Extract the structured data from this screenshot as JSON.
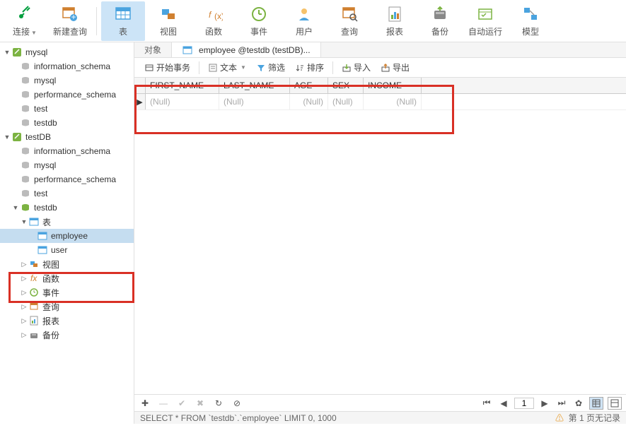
{
  "toolbar": [
    {
      "id": "connect",
      "label": "连接"
    },
    {
      "id": "newquery",
      "label": "新建查询"
    },
    {
      "id": "table",
      "label": "表",
      "active": true
    },
    {
      "id": "view",
      "label": "视图"
    },
    {
      "id": "function",
      "label": "函数"
    },
    {
      "id": "event",
      "label": "事件"
    },
    {
      "id": "user",
      "label": "用户"
    },
    {
      "id": "query",
      "label": "查询"
    },
    {
      "id": "report",
      "label": "报表"
    },
    {
      "id": "backup",
      "label": "备份"
    },
    {
      "id": "schedule",
      "label": "自动运行"
    },
    {
      "id": "model",
      "label": "模型"
    }
  ],
  "tree": {
    "conn1": {
      "label": "mysql",
      "items": [
        "information_schema",
        "mysql",
        "performance_schema",
        "test",
        "testdb"
      ]
    },
    "conn2": {
      "label": "testDB",
      "items": [
        "information_schema",
        "mysql",
        "performance_schema",
        "test"
      ],
      "open_db": {
        "label": "testdb",
        "tables_label": "表",
        "tables": [
          {
            "label": "employee",
            "selected": true
          },
          {
            "label": "user"
          }
        ],
        "folders": [
          {
            "label": "视图",
            "icon": "view"
          },
          {
            "label": "函数",
            "icon": "fx"
          },
          {
            "label": "事件",
            "icon": "event"
          },
          {
            "label": "查询",
            "icon": "query"
          },
          {
            "label": "报表",
            "icon": "report"
          },
          {
            "label": "备份",
            "icon": "backup"
          }
        ]
      }
    }
  },
  "tabs": {
    "object": "对象",
    "active": "employee @testdb (testDB)..."
  },
  "subbar": {
    "begin_txn": "开始事务",
    "text": "文本",
    "filter": "筛选",
    "sort": "排序",
    "import": "导入",
    "export": "导出"
  },
  "grid": {
    "columns": [
      "FIRST_NAME",
      "LAST_NAME",
      "AGE",
      "SEX",
      "INCOME"
    ],
    "row": [
      "(Null)",
      "(Null)",
      "(Null)",
      "(Null)",
      "(Null)"
    ]
  },
  "bottombar": {
    "page": "1"
  },
  "status": {
    "sql": "SELECT * FROM `testdb`.`employee` LIMIT 0, 1000",
    "right": "第 1 页无记录"
  }
}
